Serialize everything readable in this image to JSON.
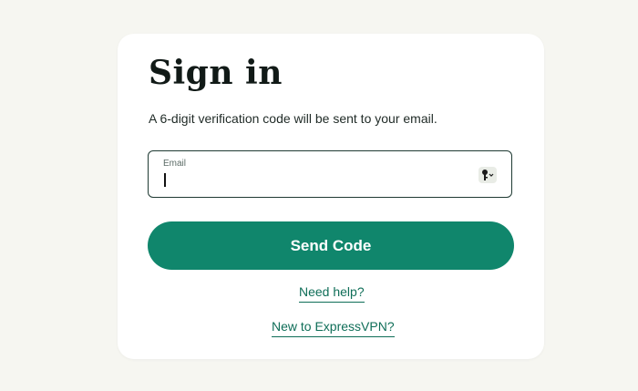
{
  "signin": {
    "title": "Sign in",
    "subtitle": "A 6-digit verification code will be sent to your email.",
    "email": {
      "label": "Email",
      "value": "",
      "placeholder": ""
    },
    "send_button_label": "Send Code",
    "help_link": "Need help?",
    "new_link": "New to ExpressVPN?"
  },
  "icons": {
    "password_manager": "key-dropdown-icon"
  },
  "colors": {
    "background": "#f6f6f1",
    "card": "#ffffff",
    "accent": "#10866c",
    "link": "#0f6e58",
    "border": "#1f3a33"
  }
}
